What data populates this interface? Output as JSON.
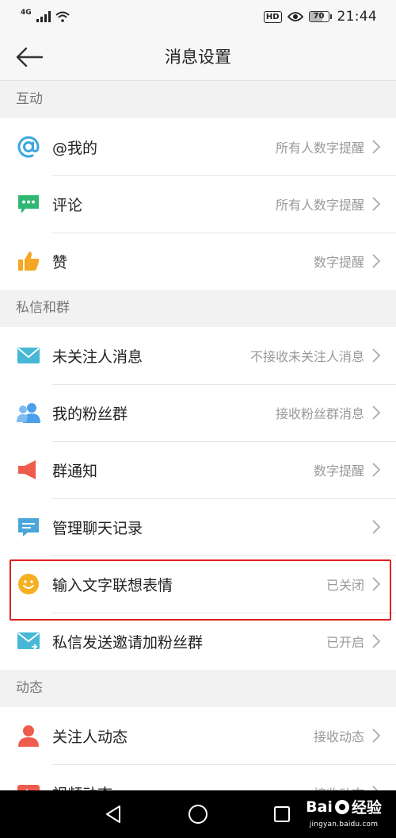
{
  "status_bar": {
    "network": "4G",
    "hd_badge": "HD",
    "battery_text": "70",
    "battery_level": 0.7,
    "time": "21:44",
    "icons": [
      "signal-icon",
      "wifi-icon",
      "hd-icon",
      "eye-icon",
      "battery-icon"
    ]
  },
  "header": {
    "title": "消息设置",
    "back_icon": "arrow-left-icon"
  },
  "sections": [
    {
      "title": "互动",
      "items": [
        {
          "label": "@我的",
          "value": "所有人数字提醒",
          "icon": "at-icon",
          "color": "#3aa6e0"
        },
        {
          "label": "评论",
          "value": "所有人数字提醒",
          "icon": "comment-icon",
          "color": "#2eb872"
        },
        {
          "label": "赞",
          "value": "数字提醒",
          "icon": "thumbs-up-icon",
          "color": "#f5a623"
        }
      ]
    },
    {
      "title": "私信和群",
      "items": [
        {
          "label": "未关注人消息",
          "value": "不接收未关注人消息",
          "icon": "mail-icon",
          "color": "#46b8d6"
        },
        {
          "label": "我的粉丝群",
          "value": "接收粉丝群消息",
          "icon": "group-icon",
          "color": "#4a9fe8"
        },
        {
          "label": "群通知",
          "value": "数字提醒",
          "icon": "speaker-icon",
          "color": "#ef5b4c"
        },
        {
          "label": "管理聊天记录",
          "value": "",
          "icon": "chat-history-icon",
          "color": "#4aa6d8"
        },
        {
          "label": "输入文字联想表情",
          "value": "已关闭",
          "icon": "smiley-icon",
          "color": "#f5b021"
        },
        {
          "label": "私信发送邀请加粉丝群",
          "value": "已开启",
          "icon": "mail-invite-icon",
          "color": "#46b8d6"
        }
      ]
    },
    {
      "title": "动态",
      "items": [
        {
          "label": "关注人动态",
          "value": "接收动态",
          "icon": "person-icon",
          "color": "#ef5b4c"
        },
        {
          "label": "视频动态",
          "value": "接收动态",
          "icon": "video-icon",
          "color": "#ef5b4c"
        }
      ]
    }
  ],
  "nav_bar": {
    "icons": [
      "back-triangle-icon",
      "home-circle-icon",
      "recents-square-icon"
    ]
  },
  "watermark": {
    "logo_text_a": "Bai",
    "logo_text_b": "经验",
    "url": "jingyan.baidu.com"
  },
  "colors": {
    "highlight": "#e02020",
    "background": "#f2f2f2",
    "row_bg": "#ffffff",
    "value_text": "#999999"
  }
}
